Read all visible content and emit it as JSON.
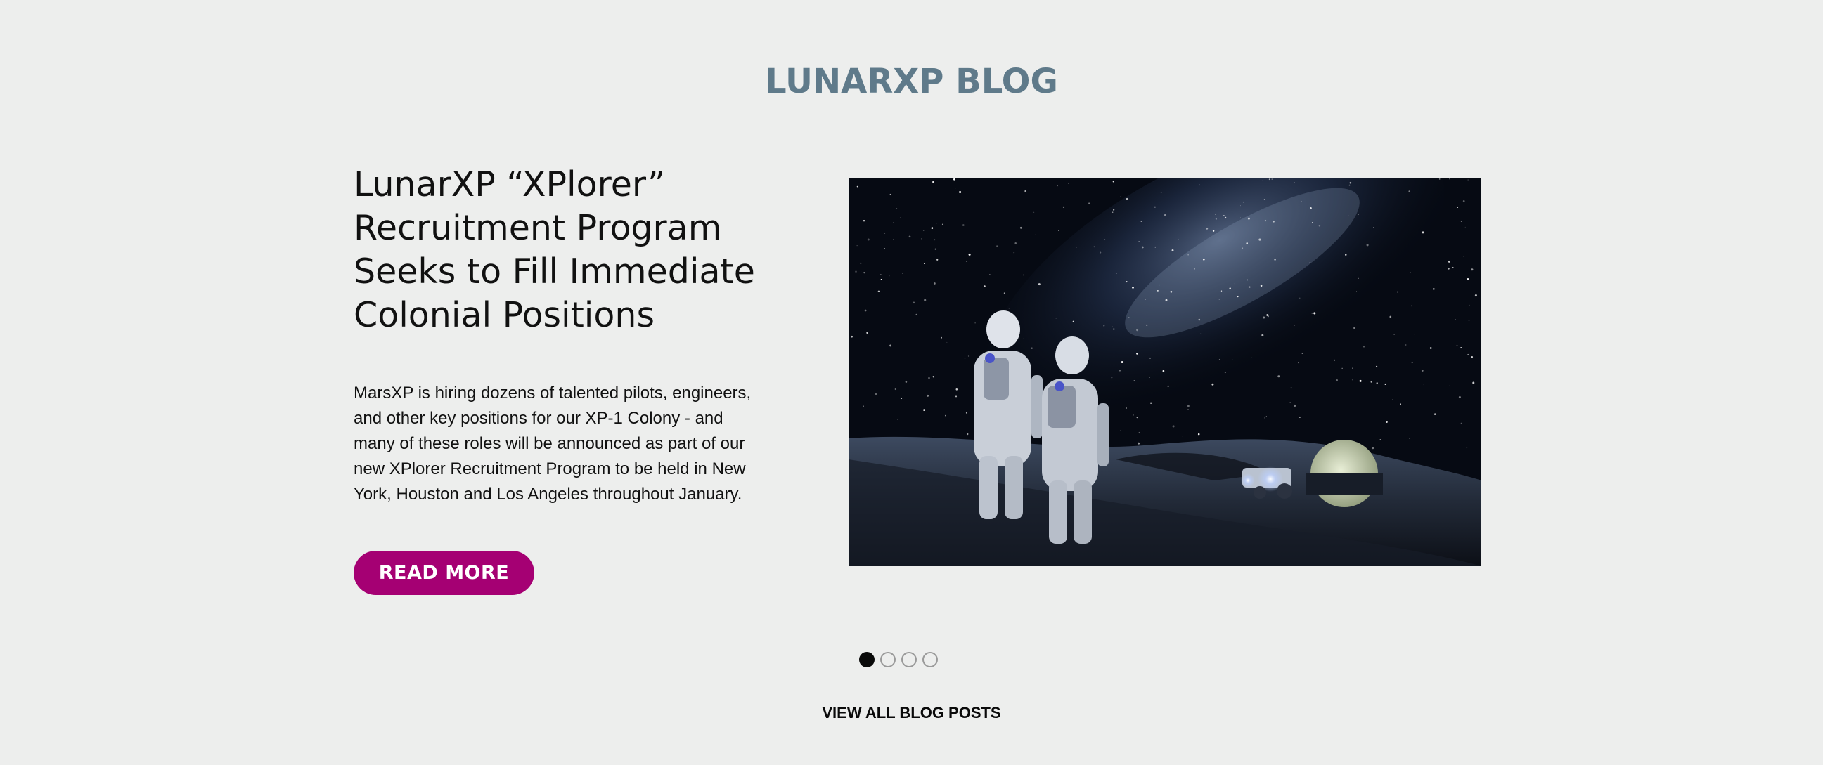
{
  "section": {
    "title": "LUNARXP BLOG"
  },
  "post": {
    "title": "LunarXP “XPlorer” Recruitment Program Seeks to Fill Immediate Colonial Positions",
    "excerpt": "MarsXP is hiring dozens of talented pilots, engineers, and other key positions for our XP-1 Colony - and many of these roles will be announced as part of our new XPlorer Recruitment Program to be held in New York, Houston and Los Angeles throughout January.",
    "read_more_label": "READ MORE",
    "image_alt": "Two astronauts standing on the lunar surface under the Milky Way, with a rover and a glowing dome in the distance"
  },
  "carousel": {
    "slides": 4,
    "active_index": 0
  },
  "footer": {
    "view_all_label": "VIEW ALL BLOG POSTS"
  },
  "colors": {
    "background": "#edeeed",
    "title": "#5f7a8a",
    "button": "#a50073",
    "text": "#111111"
  }
}
